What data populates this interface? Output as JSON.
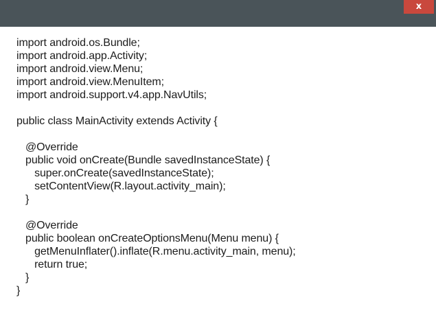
{
  "window": {
    "close_label": "x"
  },
  "code": {
    "lines": [
      "import android.os.Bundle;",
      "import android.app.Activity;",
      "import android.view.Menu;",
      "import android.view.MenuItem;",
      "import android.support.v4.app.NavUtils;",
      "",
      "public class MainActivity extends Activity {",
      "",
      "   @Override",
      "   public void onCreate(Bundle savedInstanceState) {",
      "      super.onCreate(savedInstanceState);",
      "      setContentView(R.layout.activity_main);",
      "   }",
      "",
      "   @Override",
      "   public boolean onCreateOptionsMenu(Menu menu) {",
      "      getMenuInflater().inflate(R.menu.activity_main, menu);",
      "      return true;",
      "   }",
      "}"
    ]
  }
}
